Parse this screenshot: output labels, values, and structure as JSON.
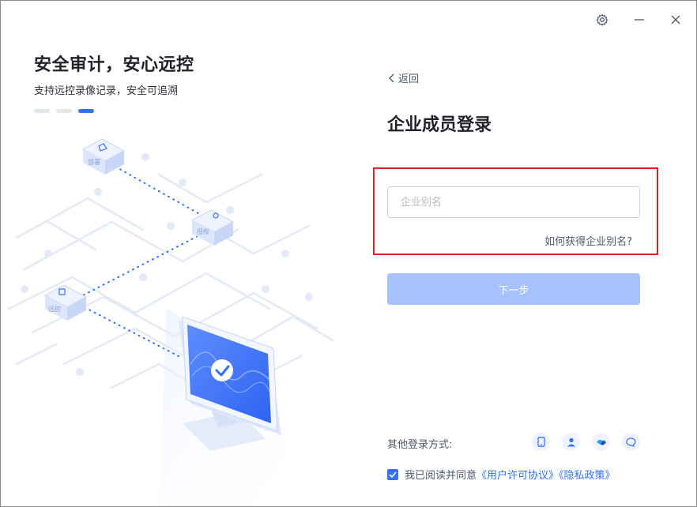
{
  "window": {
    "controls": {
      "settings_icon": "gear-icon",
      "minimize_icon": "minimize-icon",
      "close_icon": "close-icon"
    }
  },
  "hero": {
    "title": "安全审计，安心远控",
    "subtitle": "支持远控录像记录，安全可追溯",
    "carousel_dots": 3,
    "active_dot": 3,
    "illustration": {
      "node_labels": [
        "部署",
        "授权",
        "远控"
      ]
    }
  },
  "login": {
    "back_label": "返回",
    "title": "企业成员登录",
    "alias_placeholder": "企业别名",
    "alias_value": "",
    "help_link": "如何获得企业别名?",
    "next_button": "下一步",
    "other_methods_label": "其他登录方式:",
    "other_methods": [
      "phone-icon",
      "user-icon",
      "enterprise-wechat-icon",
      "chat-bubble-icon"
    ],
    "agree": {
      "checked": true,
      "text": "我已阅读并同意",
      "user_agreement": "《用户许可协议》",
      "privacy_policy": "《隐私政策》"
    }
  },
  "colors": {
    "accent": "#3370ff",
    "button_disabled": "#a6c1fb",
    "highlight_border": "#e02020",
    "text_primary": "#1f2329",
    "text_secondary": "#4e5969"
  }
}
